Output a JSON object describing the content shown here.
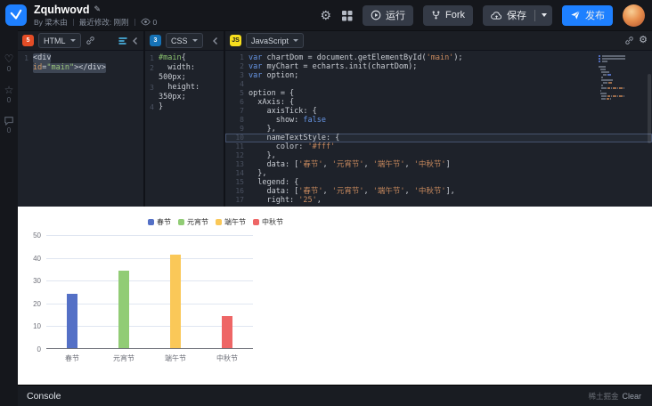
{
  "icons": {
    "gear": "⚙",
    "heart": "♡",
    "star": "☆",
    "pencil": "✎"
  },
  "header": {
    "title": "Zquhwovd",
    "byline": {
      "by_author": "By 梁木由",
      "modified": "最近修改: 刚刚",
      "views": "0"
    },
    "actions": {
      "run": "运行",
      "fork": "Fork",
      "save": "保存",
      "publish": "发布"
    }
  },
  "sidebar": {
    "likes": "0",
    "stars": "0",
    "comments": "0"
  },
  "editors": {
    "html": {
      "label": "HTML",
      "badge": "5",
      "rows": [
        {
          "n": "1",
          "sel": true,
          "t": [
            [
              "tag",
              "<div"
            ]
          ]
        },
        {
          "n": "",
          "sel": true,
          "t": [
            [
              "attr",
              "id"
            ],
            [
              "p",
              "="
            ],
            [
              "str",
              "\"main\""
            ],
            [
              "tag",
              "></div>"
            ]
          ]
        }
      ]
    },
    "css": {
      "label": "CSS",
      "badge": "3",
      "rows": [
        {
          "n": "1",
          "t": [
            [
              "csel",
              "#main"
            ],
            [
              "p",
              "{"
            ]
          ]
        },
        {
          "n": "2",
          "t": [
            [
              "p",
              "  width:"
            ]
          ]
        },
        {
          "n": "",
          "t": [
            [
              "p",
              "500px;"
            ]
          ]
        },
        {
          "n": "3",
          "t": [
            [
              "p",
              "  height:"
            ]
          ]
        },
        {
          "n": "",
          "t": [
            [
              "p",
              "350px;"
            ]
          ]
        },
        {
          "n": "4",
          "t": [
            [
              "p",
              "}"
            ]
          ]
        }
      ]
    },
    "js": {
      "label": "JavaScript",
      "badge": "JS",
      "rows": [
        {
          "n": "1",
          "t": [
            [
              "k",
              "var"
            ],
            [
              "p",
              " chartDom = document.getElementById("
            ],
            [
              "s",
              "'main'"
            ],
            [
              "p",
              ");"
            ]
          ]
        },
        {
          "n": "2",
          "t": [
            [
              "k",
              "var"
            ],
            [
              "p",
              " myChart = echarts.init(chartDom);"
            ]
          ]
        },
        {
          "n": "3",
          "t": [
            [
              "k",
              "var"
            ],
            [
              "p",
              " option;"
            ]
          ]
        },
        {
          "n": "4",
          "t": []
        },
        {
          "n": "5",
          "t": [
            [
              "p",
              "option = {"
            ]
          ]
        },
        {
          "n": "6",
          "t": [
            [
              "p",
              "  xAxis: {"
            ]
          ]
        },
        {
          "n": "7",
          "t": [
            [
              "p",
              "    axisTick: {"
            ]
          ]
        },
        {
          "n": "8",
          "t": [
            [
              "p",
              "      show: "
            ],
            [
              "b",
              "false"
            ]
          ]
        },
        {
          "n": "9",
          "t": [
            [
              "p",
              "    },"
            ]
          ]
        },
        {
          "n": "10",
          "cur": true,
          "t": [
            [
              "p",
              "    nameTextStyle: {"
            ]
          ]
        },
        {
          "n": "11",
          "t": [
            [
              "p",
              "      color: "
            ],
            [
              "s",
              "'#fff'"
            ]
          ]
        },
        {
          "n": "12",
          "t": [
            [
              "p",
              "    },"
            ]
          ]
        },
        {
          "n": "13",
          "t": [
            [
              "p",
              "    data: ["
            ],
            [
              "s",
              "'春节'"
            ],
            [
              "p",
              ", "
            ],
            [
              "s",
              "'元宵节'"
            ],
            [
              "p",
              ", "
            ],
            [
              "s",
              "'端午节'"
            ],
            [
              "p",
              ", "
            ],
            [
              "s",
              "'中秋节'"
            ],
            [
              "p",
              "]"
            ]
          ]
        },
        {
          "n": "14",
          "t": [
            [
              "p",
              "  },"
            ]
          ]
        },
        {
          "n": "15",
          "t": [
            [
              "p",
              "  legend: {"
            ]
          ]
        },
        {
          "n": "16",
          "t": [
            [
              "p",
              "    data: ["
            ],
            [
              "s",
              "'春节'"
            ],
            [
              "p",
              ", "
            ],
            [
              "s",
              "'元宵节'"
            ],
            [
              "p",
              ", "
            ],
            [
              "s",
              "'端午节'"
            ],
            [
              "p",
              ", "
            ],
            [
              "s",
              "'中秋节'"
            ],
            [
              "p",
              "],"
            ]
          ]
        },
        {
          "n": "17",
          "t": [
            [
              "p",
              "    right: "
            ],
            [
              "s",
              "'25'"
            ],
            [
              "p",
              ","
            ]
          ]
        }
      ]
    }
  },
  "console": {
    "label": "Console",
    "watermark": "稀土掘金",
    "clear": "Clear"
  },
  "chart_data": {
    "type": "bar",
    "title": "",
    "categories": [
      "春节",
      "元宵节",
      "端午节",
      "中秋节"
    ],
    "values": [
      24,
      34,
      41,
      14
    ],
    "colors": [
      "#5470c6",
      "#91cc75",
      "#fac858",
      "#ee6666"
    ],
    "legend": [
      "春节",
      "元宵节",
      "端午节",
      "中秋节"
    ],
    "legend_position": "top",
    "xlabel": "",
    "ylabel": "",
    "ylim": [
      0,
      50
    ],
    "ytick_step": 10,
    "grid": true,
    "background": "#ffffff"
  }
}
